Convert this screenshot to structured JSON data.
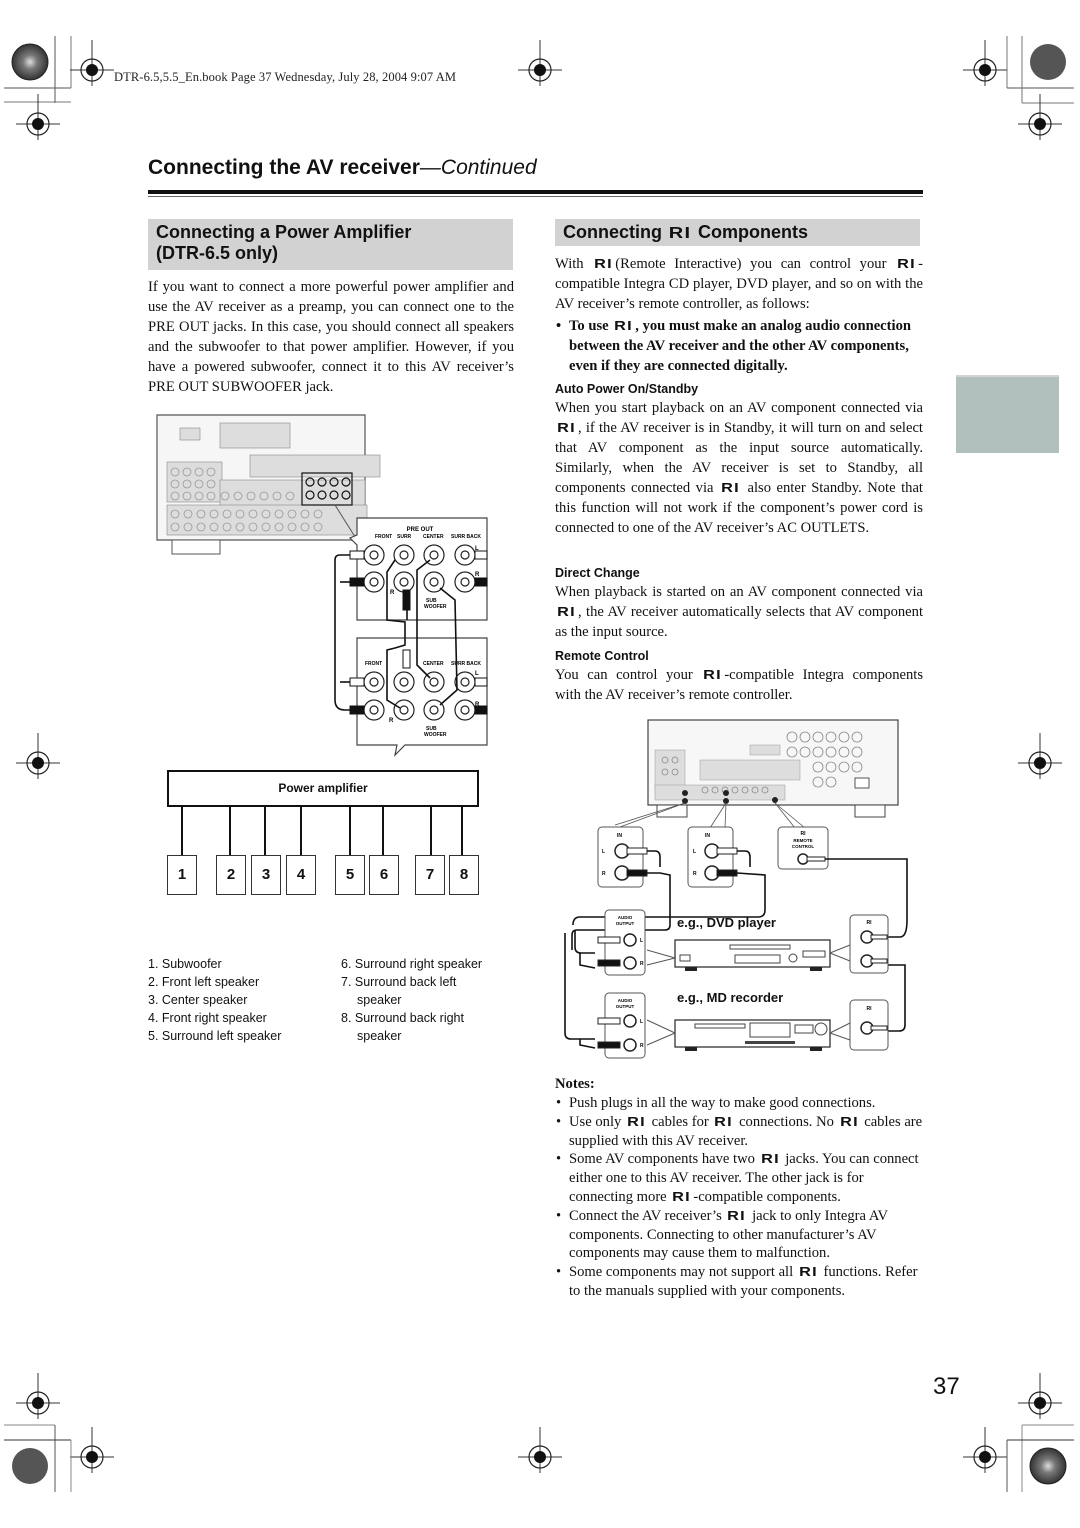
{
  "header": {
    "book_line": "DTR-6.5,5.5_En.book  Page 37  Wednesday, July 28, 2004  9:07 AM",
    "title_main": "Connecting the AV receiver",
    "title_suffix": "—Continued"
  },
  "left_section": {
    "heading_line1": "Connecting a Power Amplifier",
    "heading_line2": "(DTR-6.5 only)",
    "intro": "If you want to connect a more powerful power amplifier and use the AV receiver as a preamp, you can connect one to the PRE OUT jacks. In this case, you should connect all speakers and the subwoofer to that power amplifier. However, if you have a powered subwoofer, connect it to this AV receiver’s PRE OUT SUBWOOFER jack.",
    "diagram": {
      "panel_title": "PRE OUT",
      "labels": [
        "FRONT",
        "SURR",
        "CENTER",
        "SURR BACK",
        "L",
        "R",
        "SUB WOOFER"
      ],
      "amp_label": "Power amplifier",
      "speaker_numbers": [
        "1",
        "2",
        "3",
        "4",
        "5",
        "6",
        "7",
        "8"
      ]
    },
    "legend_left": [
      "1. Subwoofer",
      "2. Front left speaker",
      "3. Center speaker",
      "4. Front right speaker",
      "5. Surround left speaker"
    ],
    "legend_right": [
      "6. Surround right speaker",
      "7. Surround back left",
      "speaker",
      "8. Surround back right",
      "speaker"
    ]
  },
  "right_section": {
    "heading_pre": "Connecting",
    "heading_post": "Components",
    "ri_symbol": "RI",
    "intro_1": "With",
    "intro_2": "(Remote Interactive) you can control your",
    "intro_3": "-compatible Integra CD player, DVD player, and so on with the AV receiver’s remote controller, as follows:",
    "bold_bullet_1": "To use",
    "bold_bullet_2": ", you must make an analog audio connection between the AV receiver and the other AV components, even if they are connected digitally.",
    "auto_power": {
      "heading": "Auto Power On/Standby",
      "text_1": "When you start playback on an AV component connected via",
      "text_2": ", if the AV receiver is in Standby, it will turn on and select that AV component as the input source automatically. Similarly, when the AV receiver is set to Standby, all components connected via",
      "text_3": "also enter Standby. Note that this function will not work if the component’s power cord is connected to one of the AV receiver’s AC OUTLETS."
    },
    "direct_change": {
      "heading": "Direct Change",
      "text_1": "When playback is started on an AV component connected via",
      "text_2": ", the AV receiver automatically selects that AV component as the input source."
    },
    "remote_control": {
      "heading": "Remote Control",
      "text_1": "You can control your",
      "text_2": "-compatible Integra components with the AV receiver’s remote controller."
    },
    "diagram": {
      "in_label": "IN",
      "l": "L",
      "r": "R",
      "remote_control_label_1": "REMOTE",
      "remote_control_label_2": "CONTROL",
      "audio_output_1": "AUDIO",
      "audio_output_2": "OUTPUT",
      "dvd_label": "e.g., DVD player",
      "md_label": "e.g., MD recorder"
    },
    "notes": {
      "heading": "Notes:",
      "n1": "Push plugs in all the way to make good connections.",
      "n2_a": "Use only",
      "n2_b": "cables for",
      "n2_c": "connections. No",
      "n2_d": "cables are supplied with this AV receiver.",
      "n3_a": "Some AV components have two",
      "n3_b": "jacks. You can connect either one to this AV receiver. The other jack is for connecting more",
      "n3_c": "-compatible components.",
      "n4_a": "Connect the AV receiver’s",
      "n4_b": "jack to only Integra AV components. Connecting to other manufacturer’s AV components may cause them to malfunction.",
      "n5_a": "Some components may not support all",
      "n5_b": "functions. Refer to the manuals supplied with your components."
    }
  },
  "footer": {
    "page_number": "37"
  }
}
